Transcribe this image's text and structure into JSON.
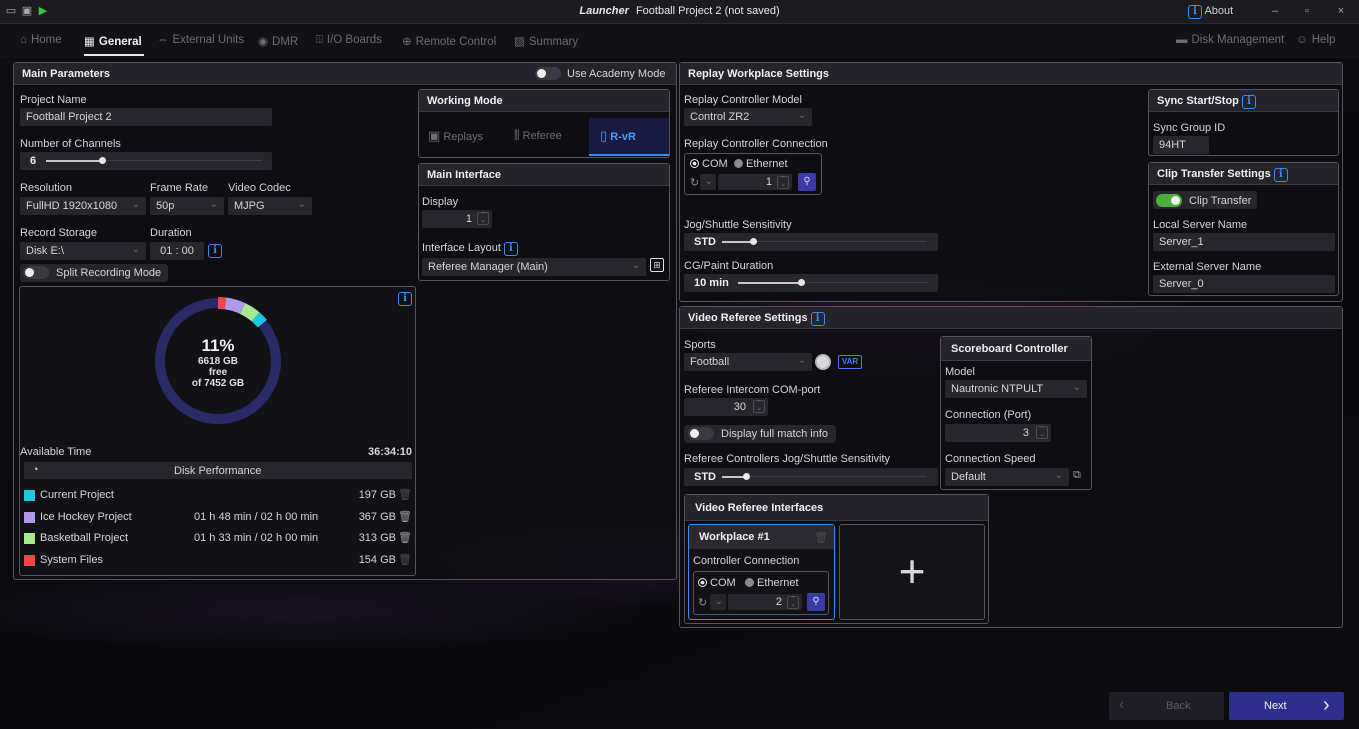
{
  "window": {
    "title_brand": "Launcher",
    "title": "Football Project 2 (not saved)",
    "about": "About",
    "controls": [
      "–",
      "▫",
      "×"
    ]
  },
  "nav": {
    "tabs": [
      {
        "label": "Home",
        "icon": "home-icon"
      },
      {
        "label": "General",
        "icon": "general-icon"
      },
      {
        "label": "External Units",
        "icon": "external-units-icon"
      },
      {
        "label": "DMR",
        "icon": "dmr-icon"
      },
      {
        "label": "I/O Boards",
        "icon": "io-boards-icon"
      },
      {
        "label": "Remote Control",
        "icon": "remote-control-icon"
      },
      {
        "label": "Summary",
        "icon": "summary-icon"
      }
    ],
    "active": "General",
    "disk_management": "Disk Management",
    "help": "Help"
  },
  "main_params": {
    "title": "Main Parameters",
    "academy_mode": "Use Academy Mode",
    "project_name_label": "Project Name",
    "project_name": "Football Project 2",
    "channels_label": "Number of Channels",
    "channels": "6",
    "channels_level": 0.26,
    "resolution_label": "Resolution",
    "resolution": "FullHD 1920x1080",
    "frame_rate_label": "Frame Rate",
    "frame_rate": "50p",
    "video_codec_label": "Video Codec",
    "video_codec": "MJPG",
    "record_storage_label": "Record Storage",
    "record_storage": "Disk E:\\",
    "duration_label": "Duration",
    "duration": "01 : 00",
    "split_recording": "Split Recording Mode"
  },
  "disk": {
    "percent": "11%",
    "free": "6618 GB",
    "free_word": "free",
    "of_total": "of 7452 GB",
    "available_time_label": "Available Time",
    "available_time": "36:34:10",
    "performance": "Disk Performance",
    "rows": [
      {
        "name": "Current Project",
        "time": "",
        "size": "197 GB",
        "color": "#1ec8e0"
      },
      {
        "name": "Ice Hockey Project",
        "time": "01 h 48 min / 02 h 00 min",
        "size": "367 GB",
        "color": "#b09ae8"
      },
      {
        "name": "Basketball Project",
        "time": "01 h 33 min / 02 h 00 min",
        "size": "313 GB",
        "color": "#a8e890"
      },
      {
        "name": "System Files",
        "time": "",
        "size": "154 GB",
        "color": "#f04848"
      }
    ]
  },
  "working_mode": {
    "title": "Working Mode",
    "modes": [
      "Replays",
      "Referee",
      "R-vR"
    ],
    "active": "R-vR"
  },
  "main_interface": {
    "title": "Main Interface",
    "display_label": "Display",
    "display": "1",
    "layout_label": "Interface Layout",
    "layout": "Referee Manager (Main)"
  },
  "replay": {
    "title": "Replay Workplace Settings",
    "model_label": "Replay Controller Model",
    "model": "Control ZR2",
    "connection_label": "Replay Controller Connection",
    "com": "COM",
    "ethernet": "Ethernet",
    "port": "1",
    "jog_label": "Jog/Shuttle Sensitivity",
    "jog": "STD",
    "jog_level": 0.15,
    "cg_label": "CG/Paint Duration",
    "cg": "10 min",
    "cg_level": 0.33
  },
  "sync": {
    "title": "Sync Start/Stop",
    "group_label": "Sync Group ID",
    "group": "94HT"
  },
  "clip": {
    "title": "Clip Transfer Settings",
    "transfer": "Clip Transfer",
    "local_label": "Local Server Name",
    "local": "Server_1",
    "external_label": "External Server Name",
    "external": "Server_0"
  },
  "vr": {
    "title": "Video Referee Settings",
    "sports_label": "Sports",
    "sports": "Football",
    "var_badge": "VAR",
    "intercom_label": "Referee Intercom COM-port",
    "intercom": "30",
    "full_match": "Display full match info",
    "jog_label": "Referee Controllers Jog/Shuttle Sensitivity",
    "jog": "STD",
    "jog_level": 0.12
  },
  "scoreboard": {
    "title": "Scoreboard Controller",
    "model_label": "Model",
    "model": "Nautronic NTPULT",
    "port_label": "Connection (Port)",
    "port": "3",
    "speed_label": "Connection Speed",
    "speed": "Default"
  },
  "vr_interfaces": {
    "title": "Video Referee Interfaces",
    "workplace": "Workplace #1",
    "conn_label": "Controller Connection",
    "com": "COM",
    "ethernet": "Ethernet",
    "port": "2",
    "add": "+"
  },
  "footer": {
    "back": "Back",
    "next": "Next"
  }
}
